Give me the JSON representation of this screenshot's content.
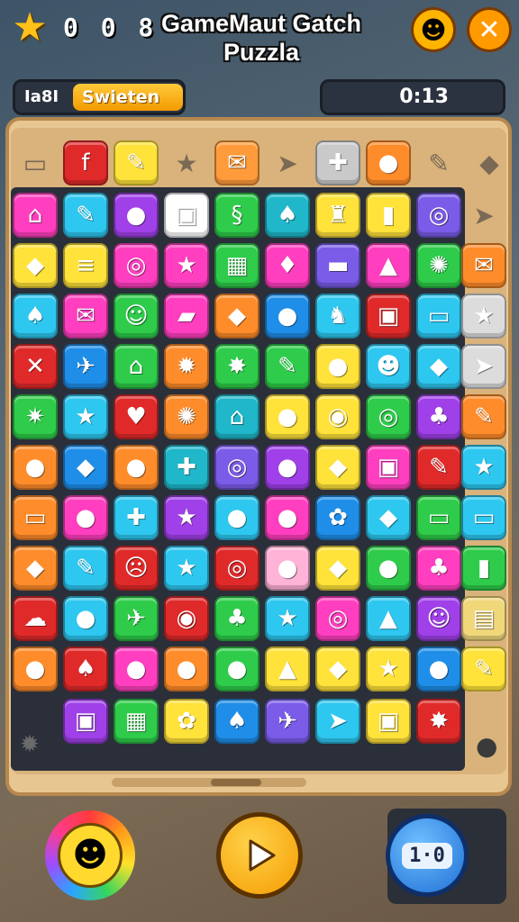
{
  "header": {
    "star_icon": "star-badge-icon",
    "counter": "0 0 8",
    "title": "GameMaut Gatch Puzzla",
    "face_icon": "smiley-face-icon",
    "close_icon": "close-icon"
  },
  "info_bar": {
    "left_label": "Ia8I",
    "left_tag": "Swieten",
    "right_value": "0:13"
  },
  "board": {
    "top_row": [
      {
        "icon": "briefcase",
        "glyph": "▭",
        "color": "#d9b27c",
        "ghost": true
      },
      {
        "icon": "f-letter",
        "glyph": "f",
        "color": "#e02a2a"
      },
      {
        "icon": "pencil",
        "glyph": "✎",
        "color": "#ffe23a"
      },
      {
        "icon": "star",
        "glyph": "★",
        "color": "#d9b27c",
        "ghost": true
      },
      {
        "icon": "envelope",
        "glyph": "✉",
        "color": "#ff9b3a"
      },
      {
        "icon": "plane",
        "glyph": "➤",
        "color": "#d9b27c",
        "ghost": true
      },
      {
        "icon": "puzzle",
        "glyph": "✚",
        "color": "#c9c9c9"
      },
      {
        "icon": "balloon",
        "glyph": "●",
        "color": "#ff8c2a"
      },
      {
        "icon": "pen",
        "glyph": "✎",
        "color": "#d9b27c",
        "ghost": true
      },
      {
        "icon": "leaf",
        "glyph": "◆",
        "color": "#d9b27c",
        "ghost": true
      }
    ],
    "rows": [
      [
        [
          "house",
          "⌂",
          "#ff3fbf"
        ],
        [
          "pencil",
          "✎",
          "#2ec7f0"
        ],
        [
          "apple",
          "●",
          "#a040e8"
        ],
        [
          "die",
          "▣",
          "#ffffff"
        ],
        [
          "swirl",
          "§",
          "#2ecc4a"
        ],
        [
          "flame",
          "♠",
          "#1fb7c9"
        ],
        [
          "cup",
          "♜",
          "#ffe23a"
        ],
        [
          "jar",
          "▮",
          "#ffe23a"
        ],
        [
          "ring",
          "◎",
          "#7a5ce8"
        ]
      ],
      [
        [
          "kite",
          "◆",
          "#ffe23a"
        ],
        [
          "hotdog",
          "≡",
          "#ffe23a"
        ],
        [
          "spiral",
          "◎",
          "#ff3fbf"
        ],
        [
          "star",
          "★",
          "#ff3fbf"
        ],
        [
          "calculator",
          "▦",
          "#2ecc4a"
        ],
        [
          "shell",
          "♦",
          "#ff3fbf"
        ],
        [
          "battery",
          "▬",
          "#7a5ce8"
        ],
        [
          "bottle",
          "▲",
          "#ff3fbf"
        ],
        [
          "virus",
          "✺",
          "#2ecc4a"
        ]
      ],
      [
        [
          "flame",
          "♠",
          "#2ec7f0"
        ],
        [
          "envelope",
          "✉",
          "#ff3fbf"
        ],
        [
          "smiley",
          "☺",
          "#2ecc4a"
        ],
        [
          "eraser",
          "▰",
          "#ff3fbf"
        ],
        [
          "leaf",
          "◆",
          "#ff8c2a"
        ],
        [
          "drop",
          "●",
          "#1f8ee8"
        ],
        [
          "cat",
          "♞",
          "#2ec7f0"
        ],
        [
          "radio",
          "▣",
          "#e02a2a"
        ],
        [
          "bandage",
          "▭",
          "#2ec7f0"
        ]
      ],
      [
        [
          "bone",
          "✕",
          "#e02a2a"
        ],
        [
          "plane",
          "✈",
          "#1f8ee8"
        ],
        [
          "house",
          "⌂",
          "#2ecc4a"
        ],
        [
          "gear",
          "✹",
          "#ff8c2a"
        ],
        [
          "splat",
          "✸",
          "#2ecc4a"
        ],
        [
          "carrot",
          "✎",
          "#2ecc4a"
        ],
        [
          "tomato",
          "●",
          "#ffe23a"
        ],
        [
          "face",
          "☻",
          "#2ec7f0"
        ],
        [
          "football",
          "◆",
          "#2ec7f0"
        ]
      ],
      [
        [
          "burst",
          "✷",
          "#2ecc4a"
        ],
        [
          "star",
          "★",
          "#2ec7f0"
        ],
        [
          "heart",
          "♥",
          "#e02a2a"
        ],
        [
          "sun",
          "✺",
          "#ff8c2a"
        ],
        [
          "house",
          "⌂",
          "#1fb7c9"
        ],
        [
          "bubble",
          "●",
          "#ffe23a"
        ],
        [
          "steak",
          "◉",
          "#ffe23a"
        ],
        [
          "clock",
          "◎",
          "#2ecc4a"
        ],
        [
          "cloud",
          "♣",
          "#a040e8"
        ]
      ],
      [
        [
          "balloon",
          "●",
          "#ff8c2a"
        ],
        [
          "leaf",
          "◆",
          "#1f8ee8"
        ],
        [
          "fish",
          "●",
          "#ff8c2a"
        ],
        [
          "puzzle",
          "✚",
          "#1fb7c9"
        ],
        [
          "target",
          "◎",
          "#7a5ce8"
        ],
        [
          "cloud",
          "●",
          "#a040e8"
        ],
        [
          "leaf",
          "◆",
          "#ffe23a"
        ],
        [
          "radio",
          "▣",
          "#ff3fbf"
        ],
        [
          "pencil",
          "✎",
          "#e02a2a"
        ]
      ],
      [
        [
          "frame",
          "▭",
          "#ff8c2a"
        ],
        [
          "bubble",
          "●",
          "#ff3fbf"
        ],
        [
          "puzzle",
          "✚",
          "#2ec7f0"
        ],
        [
          "star",
          "★",
          "#a040e8"
        ],
        [
          "orange",
          "●",
          "#2ec7f0"
        ],
        [
          "cherry",
          "●",
          "#ff3fbf"
        ],
        [
          "flower",
          "✿",
          "#1f8ee8"
        ],
        [
          "bean",
          "◆",
          "#2ec7f0"
        ],
        [
          "ticket",
          "▭",
          "#2ecc4a"
        ]
      ],
      [
        [
          "bread",
          "◆",
          "#ff8c2a"
        ],
        [
          "feather",
          "✎",
          "#2ec7f0"
        ],
        [
          "angry",
          "☹",
          "#e02a2a"
        ],
        [
          "star",
          "★",
          "#2ec7f0"
        ],
        [
          "target",
          "◎",
          "#e02a2a"
        ],
        [
          "bubble",
          "●",
          "#ffb3d6"
        ],
        [
          "note",
          "◆",
          "#ffe23a"
        ],
        [
          "lemon",
          "●",
          "#2ecc4a"
        ],
        [
          "monster",
          "♣",
          "#ff3fbf"
        ]
      ],
      [
        [
          "cloud",
          "☁",
          "#e02a2a"
        ],
        [
          "drop",
          "●",
          "#2ec7f0"
        ],
        [
          "plane",
          "✈",
          "#2ecc4a"
        ],
        [
          "burger",
          "◉",
          "#e02a2a"
        ],
        [
          "ghost",
          "♣",
          "#2ecc4a"
        ],
        [
          "star",
          "★",
          "#2ec7f0"
        ],
        [
          "ring",
          "◎",
          "#ff3fbf"
        ],
        [
          "bottle",
          "▲",
          "#2ec7f0"
        ],
        [
          "monster",
          "☺",
          "#a040e8"
        ]
      ],
      [
        [
          "pear",
          "●",
          "#ff8c2a"
        ],
        [
          "bell",
          "♠",
          "#e02a2a"
        ],
        [
          "pear",
          "●",
          "#ff3fbf"
        ],
        [
          "egg",
          "●",
          "#ff8c2a"
        ],
        [
          "peanut",
          "●",
          "#2ecc4a"
        ],
        [
          "cheese",
          "▲",
          "#ffe23a"
        ],
        [
          "banana",
          "◆",
          "#ffe23a"
        ],
        [
          "star",
          "★",
          "#ffe23a"
        ],
        [
          "drop",
          "●",
          "#1f8ee8"
        ]
      ],
      [
        null,
        [
          "bag",
          "▣",
          "#a040e8"
        ],
        [
          "calendar",
          "▦",
          "#2ecc4a"
        ],
        [
          "flower",
          "✿",
          "#ffe23a"
        ],
        [
          "bell",
          "♠",
          "#1f8ee8"
        ],
        [
          "bolt",
          "✈",
          "#7a5ce8"
        ],
        [
          "rocket",
          "➤",
          "#2ec7f0"
        ],
        [
          "box",
          "▣",
          "#ffe23a"
        ],
        [
          "burst",
          "✸",
          "#e02a2a"
        ]
      ]
    ],
    "right_column": [
      {
        "icon": "plane",
        "glyph": "➤",
        "color": "#d9b27c",
        "ghost": true
      },
      {
        "icon": "envelope",
        "glyph": "✉",
        "color": "#ff8c2a"
      },
      {
        "icon": "star",
        "glyph": "★",
        "color": "#dcdcdc"
      },
      {
        "icon": "plane",
        "glyph": "➤",
        "color": "#dcdcdc"
      },
      {
        "icon": "pen",
        "glyph": "✎",
        "color": "#ff8c2a"
      },
      {
        "icon": "star",
        "glyph": "★",
        "color": "#2ec7f0"
      },
      {
        "icon": "bag",
        "glyph": "▭",
        "color": "#2ec7f0"
      },
      {
        "icon": "bottle",
        "glyph": "▮",
        "color": "#2ecc4a"
      },
      {
        "icon": "notepad",
        "glyph": "▤",
        "color": "#f0d77a"
      },
      {
        "icon": "carrot",
        "glyph": "✎",
        "color": "#ffe23a"
      }
    ]
  },
  "footer": {
    "gear_icon": "gear-icon",
    "dot_icon": "bullet-icon",
    "sun_icon": "sun-face-icon",
    "play_icon": "play-icon",
    "score": "1·0"
  }
}
